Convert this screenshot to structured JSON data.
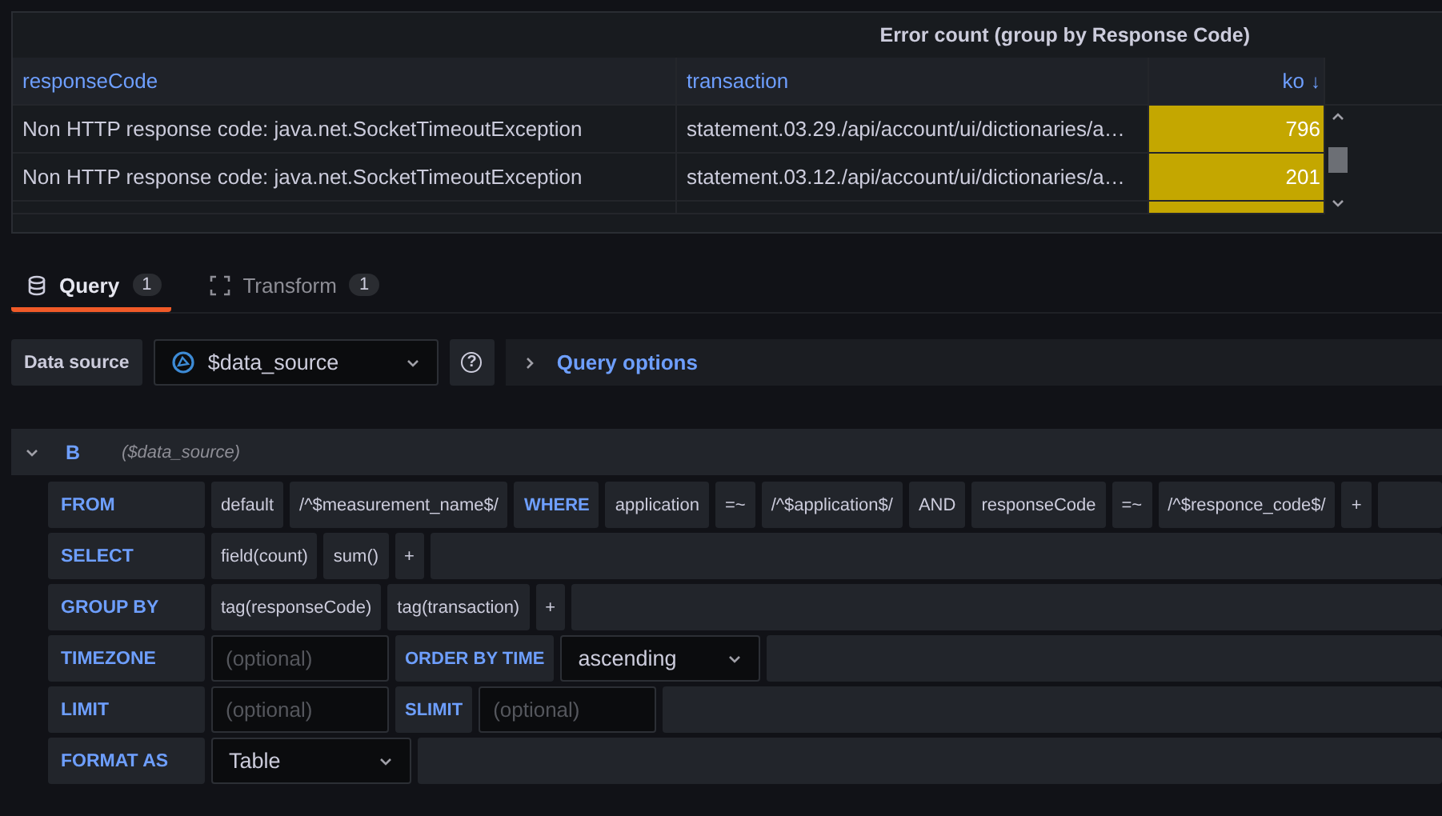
{
  "panel": {
    "title": "Error count (group by Response Code)",
    "columns": [
      {
        "label": "responseCode"
      },
      {
        "label": "transaction"
      },
      {
        "label": "ko",
        "sort_icon": "↓"
      }
    ],
    "rows": [
      [
        "Non HTTP response code: java.net.SocketTimeoutException",
        "statement.03.29./api/account/ui/dictionaries/a…",
        "796"
      ],
      [
        "Non HTTP response code: java.net.SocketTimeoutException",
        "statement.03.12./api/account/ui/dictionaries/a…",
        "201"
      ]
    ]
  },
  "tabs": [
    {
      "label": "Query",
      "count": "1",
      "selected": true
    },
    {
      "label": "Transform",
      "count": "1",
      "selected": false
    }
  ],
  "data_source": {
    "label": "Data source",
    "value": "$data_source",
    "help": "?",
    "options_label": "Query options"
  },
  "query": {
    "ref": "B",
    "source": "($data_source)",
    "expanded": true,
    "rows": [
      {
        "label": "FROM",
        "segments": [
          {
            "kind": "value",
            "text": "default"
          },
          {
            "kind": "value",
            "text": "/^$measurement_name$/"
          },
          {
            "kind": "keyword",
            "text": "WHERE"
          },
          {
            "kind": "value",
            "text": "application"
          },
          {
            "kind": "value",
            "text": "=~"
          },
          {
            "kind": "value",
            "text": "/^$application$/"
          },
          {
            "kind": "value",
            "text": "AND"
          },
          {
            "kind": "value",
            "text": "responseCode"
          },
          {
            "kind": "value",
            "text": "=~"
          },
          {
            "kind": "value",
            "text": "/^$responce_code$/"
          },
          {
            "kind": "value",
            "text": "+"
          }
        ]
      },
      {
        "label": "SELECT",
        "segments": [
          {
            "kind": "value",
            "text": "field(count)"
          },
          {
            "kind": "value",
            "text": "sum()"
          },
          {
            "kind": "value",
            "text": "+"
          }
        ]
      },
      {
        "label": "GROUP BY",
        "segments": [
          {
            "kind": "value",
            "text": "tag(responseCode)"
          },
          {
            "kind": "value",
            "text": "tag(transaction)"
          },
          {
            "kind": "value",
            "text": "+"
          }
        ]
      },
      {
        "label": "TIMEZONE",
        "segments": [
          {
            "kind": "input",
            "placeholder": "(optional)"
          },
          {
            "kind": "keyword",
            "text": "ORDER BY TIME"
          },
          {
            "kind": "select",
            "text": "ascending"
          }
        ]
      },
      {
        "label": "LIMIT",
        "segments": [
          {
            "kind": "input",
            "placeholder": "(optional)"
          },
          {
            "kind": "keyword",
            "text": "SLIMIT"
          },
          {
            "kind": "input",
            "placeholder": "(optional)"
          }
        ]
      },
      {
        "label": "FORMAT AS",
        "segments": [
          {
            "kind": "select",
            "text": "Table"
          }
        ]
      }
    ]
  }
}
